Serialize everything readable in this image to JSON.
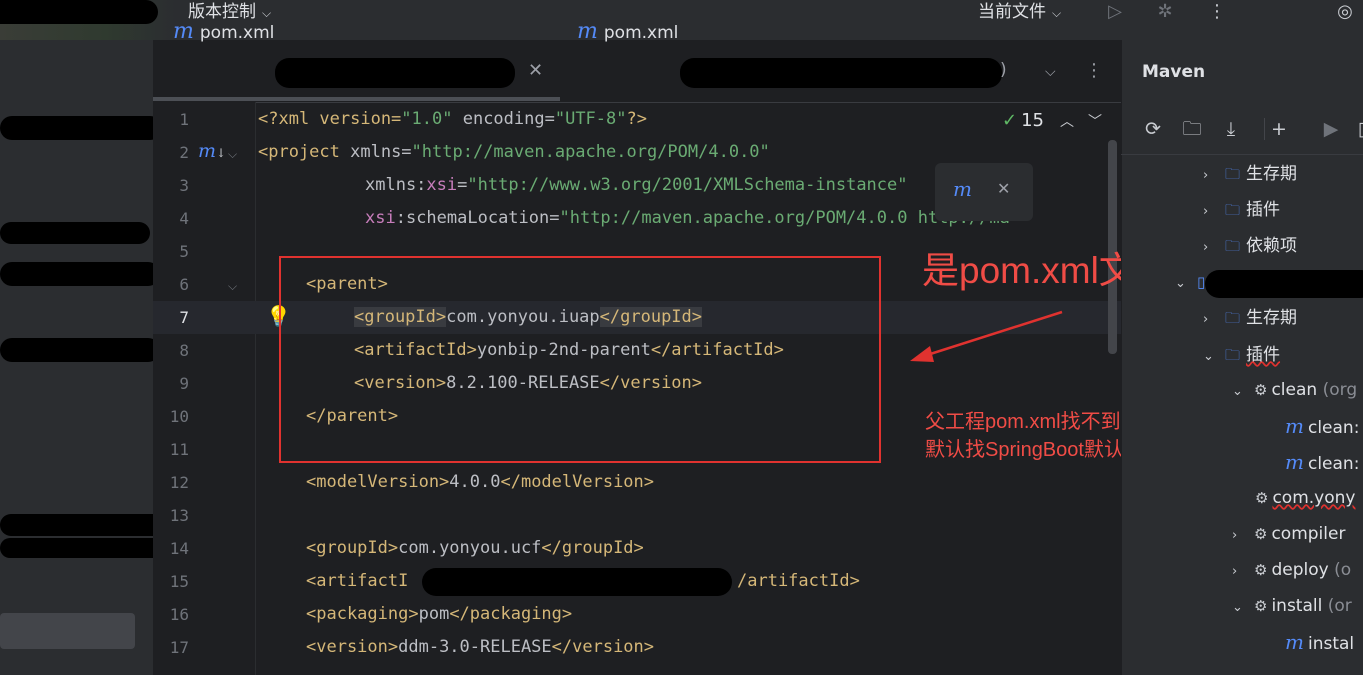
{
  "topbar": {
    "vcs_label": "版本控制",
    "current_file_label": "当前文件"
  },
  "tabs": [
    {
      "label": "pom.xml"
    },
    {
      "label": "pom.xml"
    }
  ],
  "editor": {
    "inspection_count": "15",
    "line_numbers": [
      "1",
      "2",
      "3",
      "4",
      "5",
      "6",
      "7",
      "8",
      "9",
      "10",
      "11",
      "12",
      "13",
      "14",
      "15",
      "16",
      "17"
    ],
    "lines": {
      "l1": {
        "a": "<?xml version=",
        "b": "\"1.0\"",
        "c": " encoding=",
        "d": "\"UTF-8\"",
        "e": "?>"
      },
      "l2": {
        "a": "<project ",
        "b": "xmlns=",
        "c": "\"http://maven.apache.org/POM/4.0.0\""
      },
      "l3": {
        "a": "xmlns:",
        "b": "xsi",
        "c": "=",
        "d": "\"http://www.w3.org/2001/XMLSchema-instance\""
      },
      "l4": {
        "a": "xsi",
        "b": ":schemaLocation=",
        "c": "\"http://maven.apache.org/POM/4.0.0 http://ma"
      },
      "l6": "<parent>",
      "l7": {
        "open": "<groupId>",
        "val": "com.yonyou.iuap",
        "close": "</groupId>"
      },
      "l8": {
        "open": "<artifactId>",
        "val": "yonbip-2nd-parent",
        "close": "</artifactId>"
      },
      "l9": {
        "open": "<version>",
        "val": "8.2.100-RELEASE",
        "close": "</version>"
      },
      "l10": "</parent>",
      "l12": {
        "open": "<modelVersion>",
        "val": "4.0.0",
        "close": "</modelVersion>"
      },
      "l14": {
        "open": "<groupId>",
        "val": "com.yonyou.ucf",
        "close": "</groupId>"
      },
      "l15": {
        "open": "<artifactI",
        "close": "/artifactId>"
      },
      "l16": {
        "open": "<packaging>",
        "val": "pom",
        "close": "</packaging>"
      },
      "l17": {
        "open": "<version>",
        "val": "ddm-3.0-RELEASE",
        "close": "</version>"
      }
    }
  },
  "annotations": {
    "main": "是pom.xml文件",
    "note_line1": "父工程pom.xml找不到时，",
    "note_line2": "默认找SpringBoot默认xml"
  },
  "maven": {
    "title": "Maven",
    "tree": [
      {
        "label": "生存期"
      },
      {
        "label": "插件"
      },
      {
        "label": "依赖项"
      },
      {
        "label": "生存期"
      },
      {
        "label": "插件"
      },
      {
        "label": "clean",
        "suffix": " (org"
      },
      {
        "label": "clean:"
      },
      {
        "label": "clean:"
      },
      {
        "label": "com.yony"
      },
      {
        "label": "compiler"
      },
      {
        "label": "deploy",
        "suffix": " (o"
      },
      {
        "label": "install",
        "suffix": " (or"
      },
      {
        "label": "instal"
      }
    ]
  },
  "colors": {
    "accent_blue": "#548af7",
    "annotation_red": "#e0322f",
    "xml_tag": "#d5b778",
    "xml_string": "#6aab73"
  }
}
